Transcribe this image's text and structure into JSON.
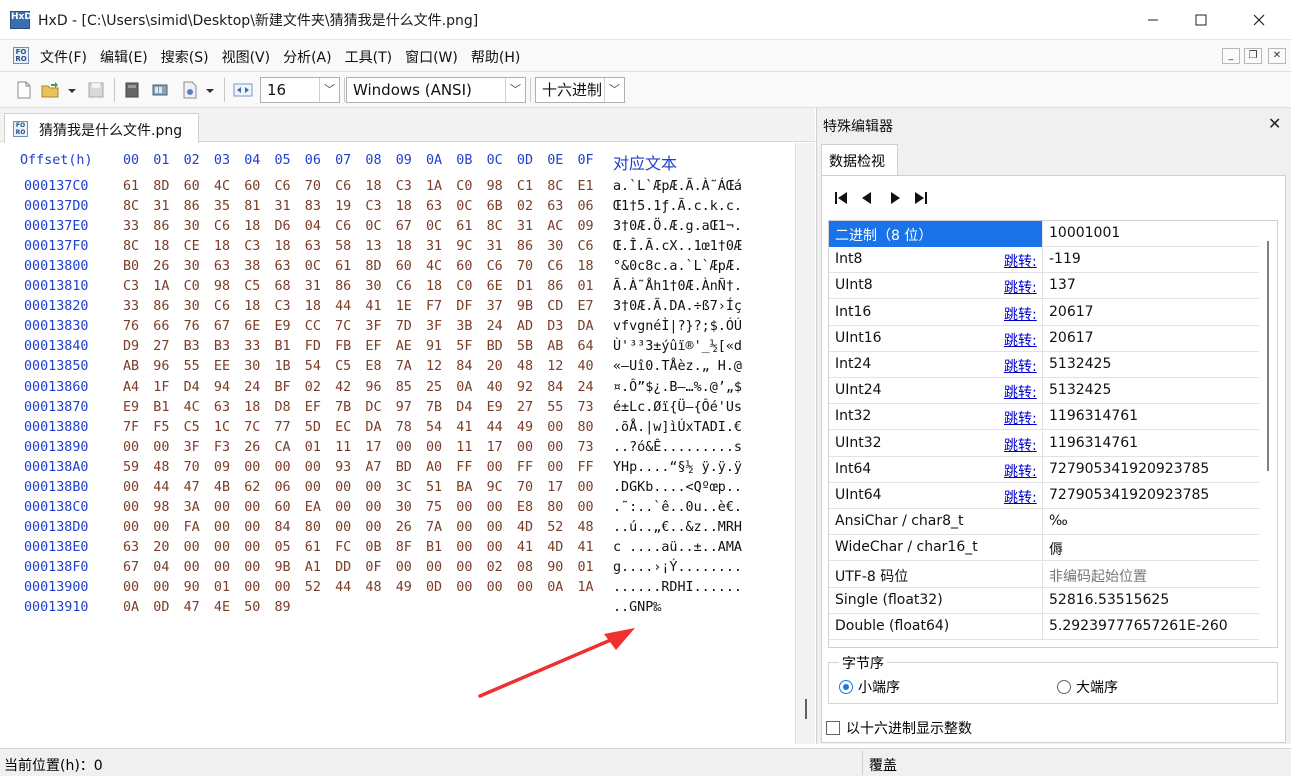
{
  "window": {
    "title": "HxD - [C:\\Users\\simid\\Desktop\\新建文件夹\\猜猜我是什么文件.png]",
    "app_icon_text": "HxD"
  },
  "menu": {
    "items": [
      "文件(F)",
      "编辑(E)",
      "搜索(S)",
      "视图(V)",
      "分析(A)",
      "工具(T)",
      "窗口(W)",
      "帮助(H)"
    ]
  },
  "toolbar": {
    "bytes_per_row": "16",
    "charset": "Windows (ANSI)",
    "offset_base": "十六进制"
  },
  "document": {
    "tab_label": "猜猜我是什么文件.png"
  },
  "hex": {
    "offset_header": "Offset(h)",
    "column_headers": [
      "00",
      "01",
      "02",
      "03",
      "04",
      "05",
      "06",
      "07",
      "08",
      "09",
      "0A",
      "0B",
      "0C",
      "0D",
      "0E",
      "0F"
    ],
    "text_header": "对应文本",
    "rows": [
      {
        "offset": "000137C0",
        "bytes": [
          "61",
          "8D",
          "60",
          "4C",
          "60",
          "C6",
          "70",
          "C6",
          "18",
          "C3",
          "1A",
          "C0",
          "98",
          "C1",
          "8C",
          "E1"
        ],
        "text": "a.`L`ÆpÆ.Ã.À˜ÁŒá"
      },
      {
        "offset": "000137D0",
        "bytes": [
          "8C",
          "31",
          "86",
          "35",
          "81",
          "31",
          "83",
          "19",
          "C3",
          "18",
          "63",
          "0C",
          "6B",
          "02",
          "63",
          "06"
        ],
        "text": "Œ1†5.1ƒ.Ã.c.k.c."
      },
      {
        "offset": "000137E0",
        "bytes": [
          "33",
          "86",
          "30",
          "C6",
          "18",
          "D6",
          "04",
          "C6",
          "0C",
          "67",
          "0C",
          "61",
          "8C",
          "31",
          "AC",
          "09"
        ],
        "text": "3†0Æ.Ö.Æ.g.aŒ1¬."
      },
      {
        "offset": "000137F0",
        "bytes": [
          "8C",
          "18",
          "CE",
          "18",
          "C3",
          "18",
          "63",
          "58",
          "13",
          "18",
          "31",
          "9C",
          "31",
          "86",
          "30",
          "C6"
        ],
        "text": "Œ.Î.Ã.cX..1œ1†0Æ"
      },
      {
        "offset": "00013800",
        "bytes": [
          "B0",
          "26",
          "30",
          "63",
          "38",
          "63",
          "0C",
          "61",
          "8D",
          "60",
          "4C",
          "60",
          "C6",
          "70",
          "C6",
          "18"
        ],
        "text": "°&0c8c.a.`L`ÆpÆ."
      },
      {
        "offset": "00013810",
        "bytes": [
          "C3",
          "1A",
          "C0",
          "98",
          "C5",
          "68",
          "31",
          "86",
          "30",
          "C6",
          "18",
          "C0",
          "6E",
          "D1",
          "86",
          "01"
        ],
        "text": "Ã.À˜Åh1†0Æ.ÀnÑ†."
      },
      {
        "offset": "00013820",
        "bytes": [
          "33",
          "86",
          "30",
          "C6",
          "18",
          "C3",
          "18",
          "44",
          "41",
          "1E",
          "F7",
          "DF",
          "37",
          "9B",
          "CD",
          "E7"
        ],
        "text": "3†0Æ.Ã.DA.÷ß7›Íç"
      },
      {
        "offset": "00013830",
        "bytes": [
          "76",
          "66",
          "76",
          "67",
          "6E",
          "E9",
          "CC",
          "7C",
          "3F",
          "7D",
          "3F",
          "3B",
          "24",
          "AD",
          "D3",
          "DA"
        ],
        "text": "vfvgnéÌ|?}?;$.ÓÚ"
      },
      {
        "offset": "00013840",
        "bytes": [
          "D9",
          "27",
          "B3",
          "B3",
          "33",
          "B1",
          "FD",
          "FB",
          "EF",
          "AE",
          "91",
          "5F",
          "BD",
          "5B",
          "AB",
          "64"
        ],
        "text": "Ù'³³3±ýûï®'_½[«d"
      },
      {
        "offset": "00013850",
        "bytes": [
          "AB",
          "96",
          "55",
          "EE",
          "30",
          "1B",
          "54",
          "C5",
          "E8",
          "7A",
          "12",
          "84",
          "20",
          "48",
          "12",
          "40"
        ],
        "text": "«–Uî0.TÅèz.„ H.@"
      },
      {
        "offset": "00013860",
        "bytes": [
          "A4",
          "1F",
          "D4",
          "94",
          "24",
          "BF",
          "02",
          "42",
          "96",
          "85",
          "25",
          "0A",
          "40",
          "92",
          "84",
          "24"
        ],
        "text": "¤.Ô”$¿.B–…%.@’„$"
      },
      {
        "offset": "00013870",
        "bytes": [
          "E9",
          "B1",
          "4C",
          "63",
          "18",
          "D8",
          "EF",
          "7B",
          "DC",
          "97",
          "7B",
          "D4",
          "E9",
          "27",
          "55",
          "73"
        ],
        "text": "é±Lc.Øï{Ü—{Ôé'Us"
      },
      {
        "offset": "00013880",
        "bytes": [
          "7F",
          "F5",
          "C5",
          "1C",
          "7C",
          "77",
          "5D",
          "EC",
          "DA",
          "78",
          "54",
          "41",
          "44",
          "49",
          "00",
          "80"
        ],
        "text": ".õÅ.|w]ìÚxTADI.€"
      },
      {
        "offset": "00013890",
        "bytes": [
          "00",
          "00",
          "3F",
          "F3",
          "26",
          "CA",
          "01",
          "11",
          "17",
          "00",
          "00",
          "11",
          "17",
          "00",
          "00",
          "73"
        ],
        "text": "..?ó&Ê.........s"
      },
      {
        "offset": "000138A0",
        "bytes": [
          "59",
          "48",
          "70",
          "09",
          "00",
          "00",
          "00",
          "93",
          "A7",
          "BD",
          "A0",
          "FF",
          "00",
          "FF",
          "00",
          "FF"
        ],
        "text": "YHp....“§½ ÿ.ÿ.ÿ"
      },
      {
        "offset": "000138B0",
        "bytes": [
          "00",
          "44",
          "47",
          "4B",
          "62",
          "06",
          "00",
          "00",
          "00",
          "3C",
          "51",
          "BA",
          "9C",
          "70",
          "17",
          "00"
        ],
        "text": ".DGKb....<Qºœp.."
      },
      {
        "offset": "000138C0",
        "bytes": [
          "00",
          "98",
          "3A",
          "00",
          "00",
          "60",
          "EA",
          "00",
          "00",
          "30",
          "75",
          "00",
          "00",
          "E8",
          "80",
          "00"
        ],
        "text": ".˜:..`ê..0u..è€."
      },
      {
        "offset": "000138D0",
        "bytes": [
          "00",
          "00",
          "FA",
          "00",
          "00",
          "84",
          "80",
          "00",
          "00",
          "26",
          "7A",
          "00",
          "00",
          "4D",
          "52",
          "48"
        ],
        "text": "..ú..„€..&z..MRH"
      },
      {
        "offset": "000138E0",
        "bytes": [
          "63",
          "20",
          "00",
          "00",
          "00",
          "05",
          "61",
          "FC",
          "0B",
          "8F",
          "B1",
          "00",
          "00",
          "41",
          "4D",
          "41"
        ],
        "text": "c ....aü..±..AMA"
      },
      {
        "offset": "000138F0",
        "bytes": [
          "67",
          "04",
          "00",
          "00",
          "00",
          "9B",
          "A1",
          "DD",
          "0F",
          "00",
          "00",
          "00",
          "02",
          "08",
          "90",
          "01"
        ],
        "text": "g....›¡Ý........"
      },
      {
        "offset": "00013900",
        "bytes": [
          "00",
          "00",
          "90",
          "01",
          "00",
          "00",
          "52",
          "44",
          "48",
          "49",
          "0D",
          "00",
          "00",
          "00",
          "0A",
          "1A"
        ],
        "text": "......RDHI......"
      },
      {
        "offset": "00013910",
        "bytes": [
          "0A",
          "0D",
          "47",
          "4E",
          "50",
          "89"
        ],
        "text": "..GNP‰"
      }
    ]
  },
  "panel": {
    "title": "特殊编辑器",
    "tab": "数据检视",
    "jump_label": "跳转:",
    "rows": [
      {
        "name": "二进制（8 位）",
        "value": "10001001",
        "jump": false,
        "selected": true
      },
      {
        "name": "Int8",
        "value": "-119",
        "jump": true
      },
      {
        "name": "UInt8",
        "value": "137",
        "jump": true
      },
      {
        "name": "Int16",
        "value": "20617",
        "jump": true
      },
      {
        "name": "UInt16",
        "value": "20617",
        "jump": true
      },
      {
        "name": "Int24",
        "value": "5132425",
        "jump": true
      },
      {
        "name": "UInt24",
        "value": "5132425",
        "jump": true
      },
      {
        "name": "Int32",
        "value": "1196314761",
        "jump": true
      },
      {
        "name": "UInt32",
        "value": "1196314761",
        "jump": true
      },
      {
        "name": "Int64",
        "value": "727905341920923785",
        "jump": true
      },
      {
        "name": "UInt64",
        "value": "727905341920923785",
        "jump": true
      },
      {
        "name": "AnsiChar / char8_t",
        "value": "‰",
        "jump": false
      },
      {
        "name": "WideChar / char16_t",
        "value": "傉",
        "jump": false
      },
      {
        "name": "UTF-8 码位",
        "value": "非编码起始位置",
        "jump": false,
        "muted": true
      },
      {
        "name": "Single (float32)",
        "value": "52816.53515625",
        "jump": false
      },
      {
        "name": "Double (float64)",
        "value": "5.29239777657261E-260",
        "jump": false
      }
    ],
    "byte_order_title": "字节序",
    "little_endian": "小端序",
    "big_endian": "大端序",
    "hex_int_label": "以十六进制显示整数"
  },
  "status": {
    "position": "当前位置(h)：0",
    "mode": "覆盖"
  },
  "colors": {
    "offset_blue": "#1f3fcf",
    "byte_brown": "#7a3d28",
    "selection_blue": "#1a73e8",
    "annotation_red": "#ee3030"
  }
}
